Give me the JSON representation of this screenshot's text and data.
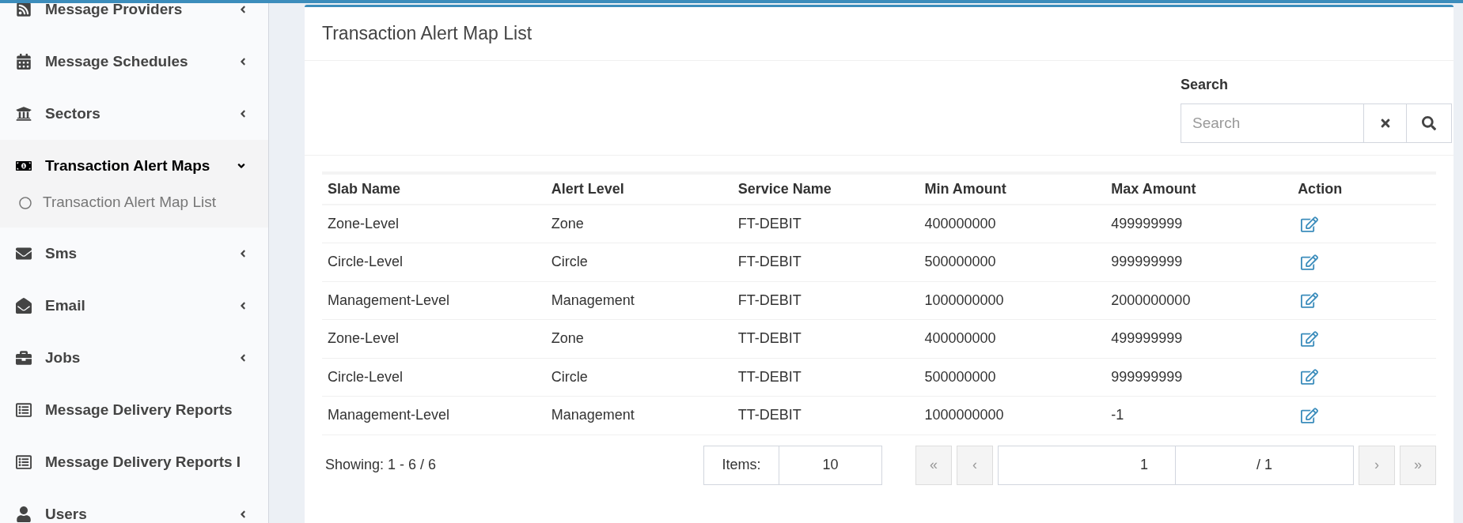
{
  "sidebar": {
    "items": [
      {
        "label": "Message Providers",
        "expandable": true,
        "expanded": false,
        "selected": false
      },
      {
        "label": "Message Schedules",
        "expandable": true,
        "expanded": false,
        "selected": false
      },
      {
        "label": "Sectors",
        "expandable": true,
        "expanded": false,
        "selected": false
      },
      {
        "label": "Transaction Alert Maps",
        "expandable": true,
        "expanded": true,
        "selected": true,
        "children": [
          {
            "label": "Transaction Alert Map List",
            "selected": false
          }
        ]
      },
      {
        "label": "Sms",
        "expandable": true,
        "expanded": false,
        "selected": false
      },
      {
        "label": "Email",
        "expandable": true,
        "expanded": false,
        "selected": false
      },
      {
        "label": "Jobs",
        "expandable": true,
        "expanded": false,
        "selected": false
      },
      {
        "label": "Message Delivery Reports",
        "expandable": false,
        "expanded": false,
        "selected": false
      },
      {
        "label": "Message Delivery Reports I",
        "expandable": false,
        "expanded": false,
        "selected": false
      },
      {
        "label": "Users",
        "expandable": true,
        "expanded": false,
        "selected": false
      }
    ]
  },
  "card": {
    "title": "Transaction Alert Map List",
    "search": {
      "label": "Search",
      "placeholder": "Search"
    },
    "table": {
      "columns": [
        "Slab Name",
        "Alert Level",
        "Service Name",
        "Min Amount",
        "Max Amount",
        "Action"
      ],
      "rows": [
        [
          "Zone-Level",
          "Zone",
          "FT-DEBIT",
          "400000000",
          "499999999"
        ],
        [
          "Circle-Level",
          "Circle",
          "FT-DEBIT",
          "500000000",
          "999999999"
        ],
        [
          "Management-Level",
          "Management",
          "FT-DEBIT",
          "1000000000",
          "2000000000"
        ],
        [
          "Zone-Level",
          "Zone",
          "TT-DEBIT",
          "400000000",
          "499999999"
        ],
        [
          "Circle-Level",
          "Circle",
          "TT-DEBIT",
          "500000000",
          "999999999"
        ],
        [
          "Management-Level",
          "Management",
          "TT-DEBIT",
          "1000000000",
          "-1"
        ]
      ]
    },
    "footer": {
      "showing": "Showing: 1 - 6 / 6",
      "items_label": "Items:",
      "items_value": "10",
      "first": "«",
      "prev": "‹",
      "page": "1",
      "total": "/ 1",
      "next": "›",
      "last": "»"
    }
  }
}
